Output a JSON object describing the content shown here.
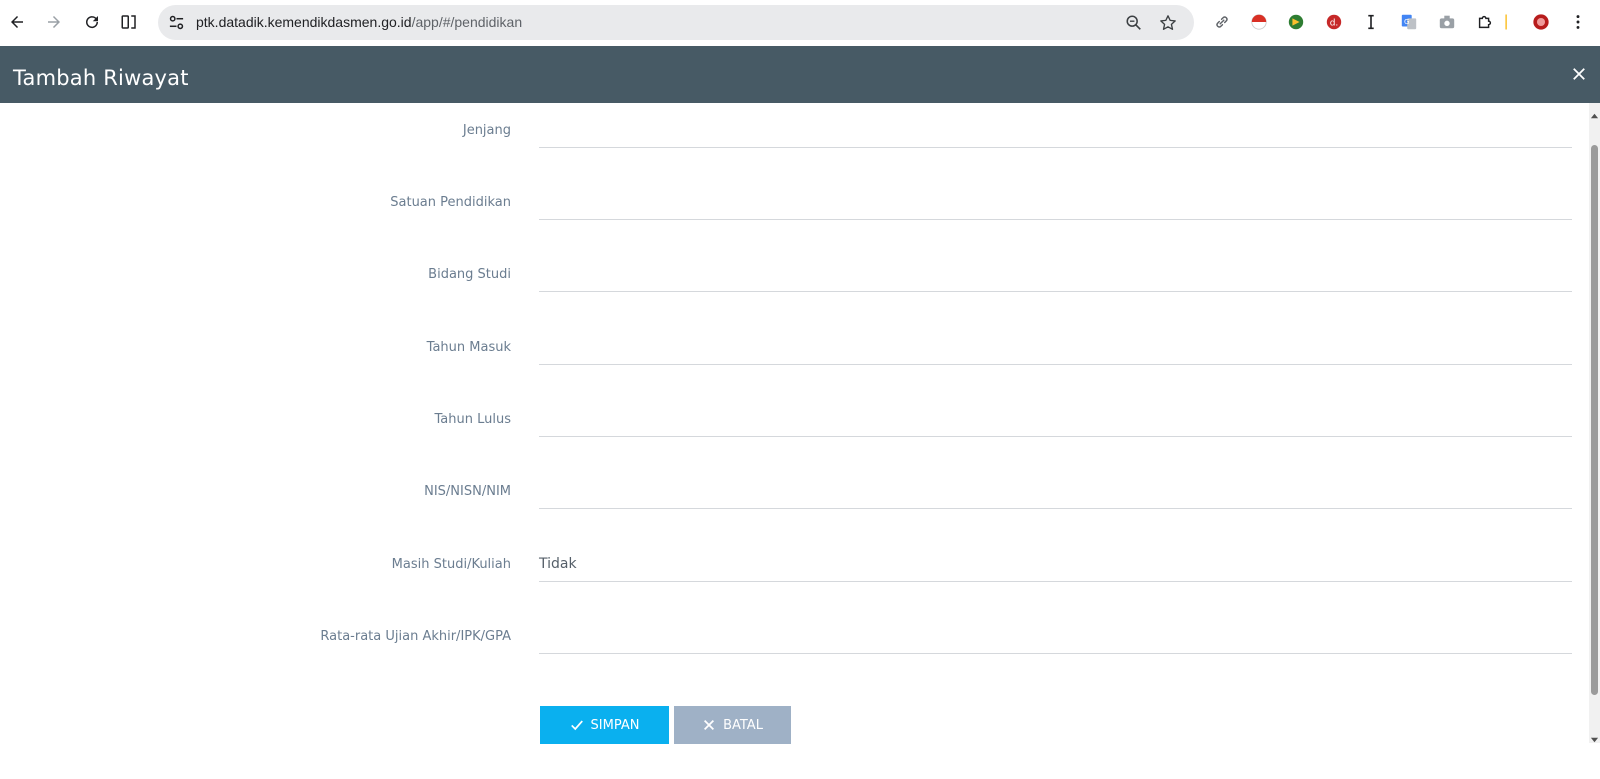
{
  "browser": {
    "url_host": "ptk.datadik.kemendikdasmen.go.id",
    "url_path": "/app/#/pendidikan",
    "icons": [
      "back-icon",
      "forward-icon",
      "reload-icon",
      "split-view-icon",
      "site-info-icon",
      "zoom-icon",
      "bookmark-star-icon",
      "link-icon",
      "extension-icons",
      "extensions-puzzle-icon",
      "profile-icon",
      "menu-icon"
    ]
  },
  "modal": {
    "title": "Tambah Riwayat",
    "close_icon": "close-icon"
  },
  "form": {
    "fields": [
      {
        "label": "Jenjang",
        "value": ""
      },
      {
        "label": "Satuan Pendidikan",
        "value": ""
      },
      {
        "label": "Bidang Studi",
        "value": ""
      },
      {
        "label": "Tahun Masuk",
        "value": ""
      },
      {
        "label": "Tahun Lulus",
        "value": ""
      },
      {
        "label": "NIS/NISN/NIM",
        "value": ""
      },
      {
        "label": "Masih Studi/Kuliah",
        "value": "Tidak"
      },
      {
        "label": "Rata-rata Ujian Akhir/IPK/GPA",
        "value": ""
      }
    ],
    "save_label": "SIMPAN",
    "cancel_label": "BATAL"
  },
  "colors": {
    "header_bg": "#475a65",
    "save_bg": "#0ab0ef",
    "cancel_bg": "#9fb1c6"
  }
}
